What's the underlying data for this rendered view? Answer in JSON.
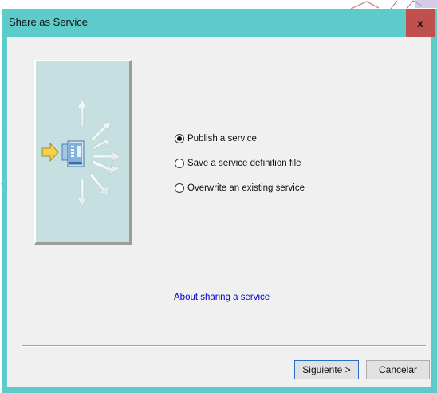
{
  "dialog": {
    "title": "Share as Service",
    "close_label": "x"
  },
  "options": [
    {
      "label": "Publish a service",
      "checked": true
    },
    {
      "label": "Save a service definition file",
      "checked": false
    },
    {
      "label": "Overwrite an existing service",
      "checked": false
    }
  ],
  "link": {
    "label": "About sharing a service"
  },
  "buttons": {
    "next_label": "Siguiente >",
    "cancel_label": "Cancelar"
  },
  "colors": {
    "titlebar": "#5ecbcb",
    "close_button": "#c0504b",
    "client_bg": "#f0f0f0",
    "illustration_bg": "#c6dfe0",
    "link": "#0000cc"
  },
  "icons": {
    "illustration": "server-broadcast-icon",
    "arrow": "yellow-arrow-icon"
  }
}
